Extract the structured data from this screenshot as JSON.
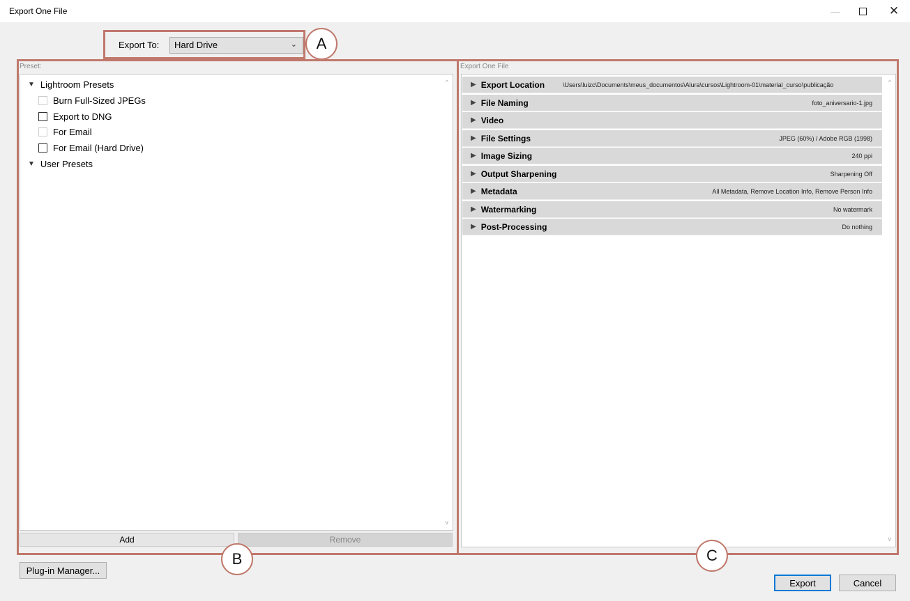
{
  "window": {
    "title": "Export One File",
    "controls": {
      "minimize": "—",
      "maximize": "",
      "close": "✕"
    }
  },
  "export_to": {
    "label": "Export To:",
    "selected": "Hard Drive"
  },
  "preset_panel": {
    "label": "Preset:",
    "tree": [
      {
        "type": "group",
        "label": "Lightroom Presets"
      },
      {
        "type": "item",
        "label": "Burn Full-Sized JPEGs",
        "enabled": false
      },
      {
        "type": "item",
        "label": "Export to DNG",
        "enabled": true
      },
      {
        "type": "item",
        "label": "For Email",
        "enabled": false
      },
      {
        "type": "item",
        "label": "For Email (Hard Drive)",
        "enabled": true
      },
      {
        "type": "group",
        "label": "User Presets"
      }
    ],
    "add_label": "Add",
    "remove_label": "Remove"
  },
  "settings_panel": {
    "label": "Export One File",
    "sections": [
      {
        "name": "Export Location",
        "value": "\\Users\\luizc\\Documents\\meus_documentos\\Alura\\cursos\\Lightroom-01\\material_curso\\publicação"
      },
      {
        "name": "File Naming",
        "value": "foto_aniversario-1.jpg"
      },
      {
        "name": "Video",
        "value": ""
      },
      {
        "name": "File Settings",
        "value": "JPEG (60%) / Adobe RGB (1998)"
      },
      {
        "name": "Image Sizing",
        "value": "240 ppi"
      },
      {
        "name": "Output Sharpening",
        "value": "Sharpening Off"
      },
      {
        "name": "Metadata",
        "value": "All Metadata, Remove Location Info, Remove Person Info"
      },
      {
        "name": "Watermarking",
        "value": "No watermark"
      },
      {
        "name": "Post-Processing",
        "value": "Do nothing"
      }
    ]
  },
  "footer": {
    "plugin_manager_label": "Plug-in Manager...",
    "export_label": "Export",
    "cancel_label": "Cancel"
  },
  "annotations": {
    "a": "A",
    "b": "B",
    "c": "C"
  },
  "icons": {
    "expand_triangle": "▶",
    "collapse_triangle": "▼",
    "chevron_down": "⌄",
    "scroll_up": "^",
    "scroll_down": "v"
  },
  "colors": {
    "annotation": "#c0786c",
    "default_button_border": "#0078d7"
  }
}
